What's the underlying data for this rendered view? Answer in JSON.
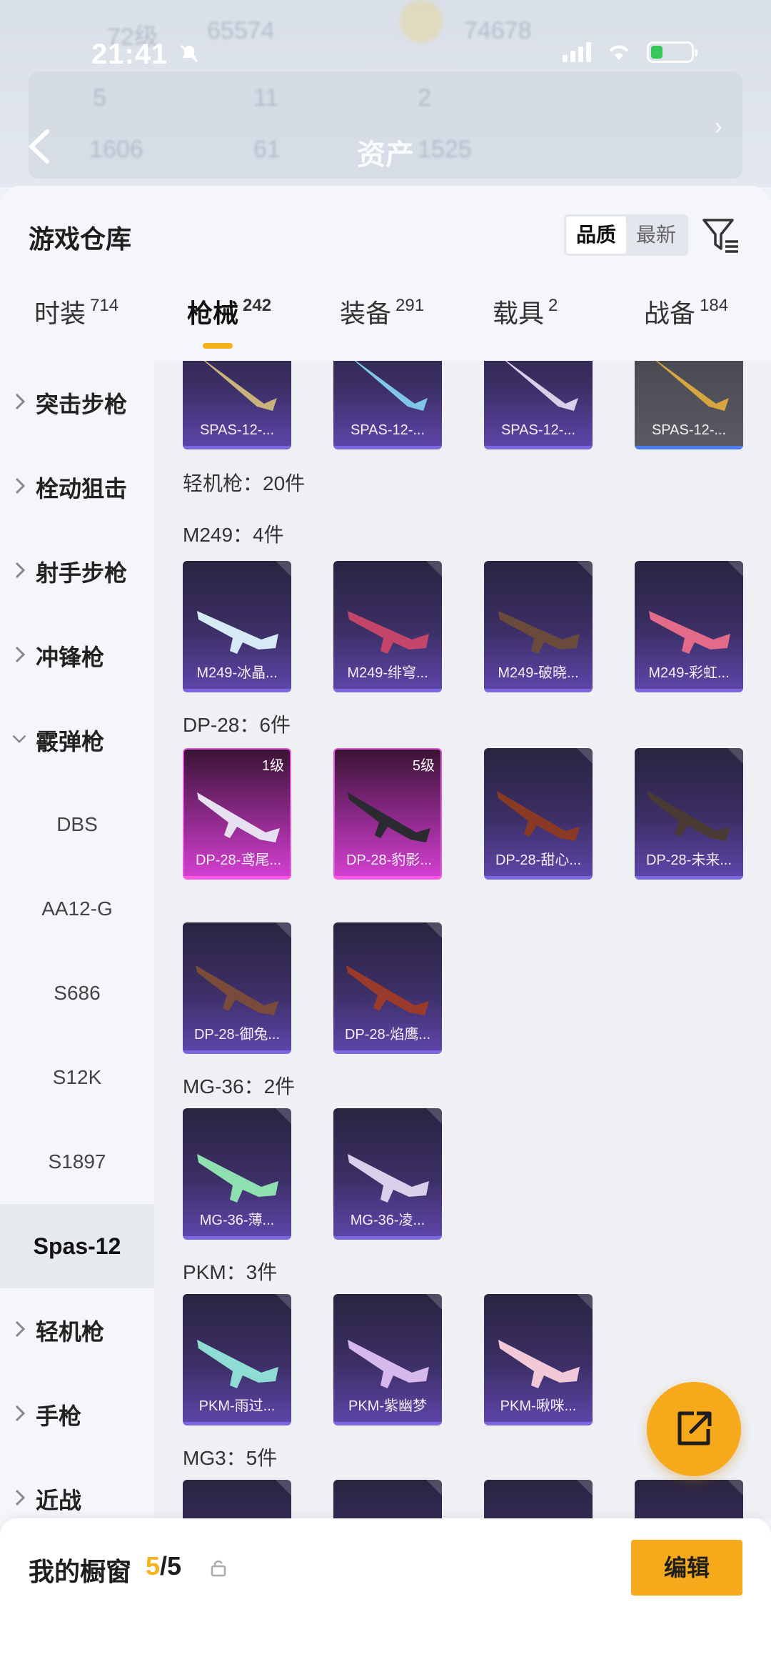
{
  "status_bar": {
    "time": "21:41"
  },
  "background_header": {
    "title": "资产",
    "ghost_texts": [
      "72级",
      "65574",
      "74678",
      "5",
      "11",
      "2",
      "1606",
      "61",
      "1525"
    ]
  },
  "sheet": {
    "title": "游戏仓库",
    "sort": {
      "options": [
        "品质",
        "最新"
      ],
      "active": "品质"
    }
  },
  "tabs": [
    {
      "label": "时装",
      "count": "714"
    },
    {
      "label": "枪械",
      "count": "242",
      "active": true
    },
    {
      "label": "装备",
      "count": "291"
    },
    {
      "label": "载具",
      "count": "2"
    },
    {
      "label": "战备",
      "count": "184"
    }
  ],
  "sidebar": {
    "categories": [
      "突击步枪",
      "栓动狙击",
      "射手步枪",
      "冲锋枪",
      "霰弹枪"
    ],
    "shotgun_subs": [
      "DBS",
      "AA12-G",
      "S686",
      "S12K",
      "S1897"
    ],
    "current": "Spas-12",
    "more_categories": [
      "轻机枪",
      "手枪",
      "近战"
    ]
  },
  "grid": {
    "top_row": [
      "SPAS-12-...",
      "SPAS-12-...",
      "SPAS-12-...",
      "SPAS-12-..."
    ],
    "lmg_header": "轻机枪：20件",
    "m249_header": "M249：4件",
    "m249": [
      "M249-冰晶...",
      "M249-绯穹...",
      "M249-破晓...",
      "M249-彩虹..."
    ],
    "dp28_header": "DP-28：6件",
    "dp28": [
      {
        "name": "DP-28-鸢尾...",
        "level": "1级"
      },
      {
        "name": "DP-28-豹影...",
        "level": "5级"
      },
      {
        "name": "DP-28-甜心..."
      },
      {
        "name": "DP-28-未来..."
      },
      {
        "name": "DP-28-御兔..."
      },
      {
        "name": "DP-28-焰鹰..."
      }
    ],
    "mg36_header": "MG-36：2件",
    "mg36": [
      "MG-36-薄...",
      "MG-36-凌..."
    ],
    "pkm_header": "PKM：3件",
    "pkm": [
      "PKM-雨过...",
      "PKM-紫幽梦",
      "PKM-啾咪..."
    ],
    "mg3_header": "MG3：5件"
  },
  "bottom_bar": {
    "label": "我的橱窗",
    "current": "5",
    "total": "/5",
    "edit": "编辑"
  },
  "colors": {
    "accent": "#f6b21b",
    "card_blue": "#3c2f66",
    "card_pink": "#d23fcf"
  }
}
